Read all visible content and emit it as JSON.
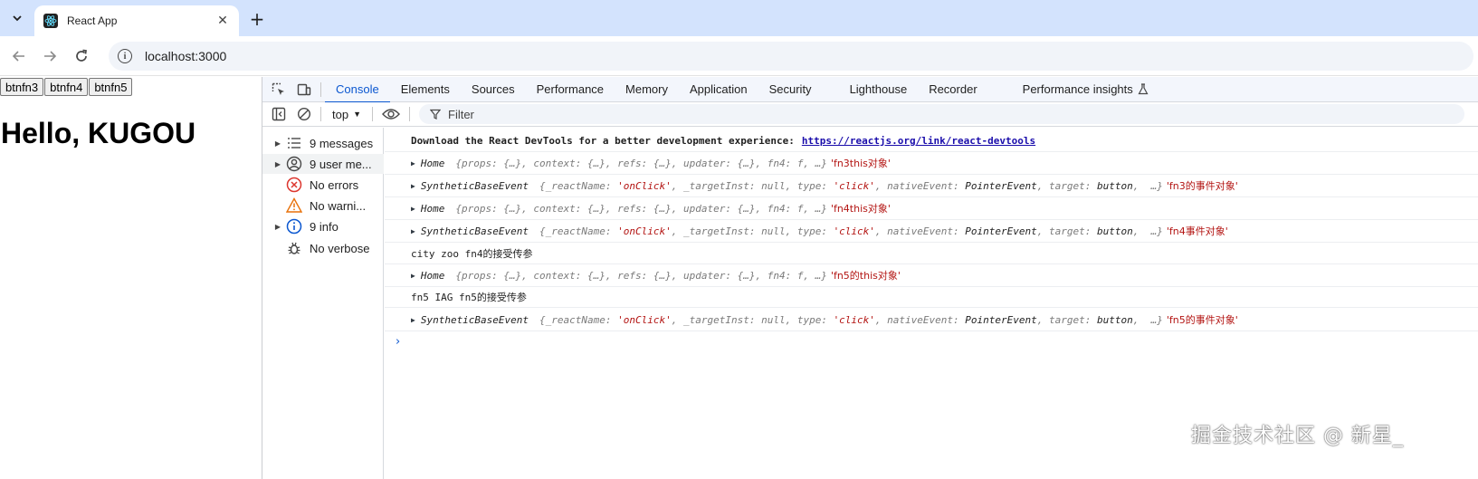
{
  "browser": {
    "tab_title": "React App",
    "url": "localhost:3000"
  },
  "page": {
    "buttons": [
      "btnfn3",
      "btnfn4",
      "btnfn5"
    ],
    "heading": "Hello, KUGOU"
  },
  "devtools": {
    "tabs": [
      "Console",
      "Elements",
      "Sources",
      "Performance",
      "Memory",
      "Application",
      "Security",
      "Lighthouse",
      "Recorder",
      "Performance insights"
    ],
    "active_tab": "Console",
    "context": "top",
    "filter_placeholder": "Filter",
    "sidebar": [
      {
        "label": "9 messages",
        "icon": "list-icon",
        "expandable": true
      },
      {
        "label": "9 user me...",
        "icon": "user-icon",
        "expandable": true,
        "selected": true
      },
      {
        "label": "No errors",
        "icon": "error-icon",
        "expandable": false
      },
      {
        "label": "No warni...",
        "icon": "warning-icon",
        "expandable": false
      },
      {
        "label": "9 info",
        "icon": "info-icon",
        "expandable": true
      },
      {
        "label": "No verbose",
        "icon": "bug-icon",
        "expandable": false
      }
    ],
    "console": {
      "banner_text": "Download the React DevTools for a better development experience:",
      "banner_link": "https://reactjs.org/link/react-devtools",
      "home_preview": "{props: {…}, context: {…}, refs: {…}, updater: {…}, fn4: f,  …}",
      "event_preview_a": "{_reactName: ",
      "event_preview_b": "'onClick'",
      "event_preview_c": ", _targetInst: null, type: ",
      "event_preview_d": "'click'",
      "event_preview_e": ", nativeEvent: ",
      "event_preview_f": "PointerEvent",
      "event_preview_g": ", target: ",
      "event_preview_h": "button",
      "event_preview_i": ",  …}",
      "home_label": "Home",
      "event_label": "SyntheticBaseEvent",
      "messages": [
        {
          "kind": "home",
          "tail": "'fn3this对象'"
        },
        {
          "kind": "event",
          "tail": "'fn3的事件对象'"
        },
        {
          "kind": "home",
          "tail": "'fn4this对象'"
        },
        {
          "kind": "event",
          "tail": "'fn4事件对象'"
        },
        {
          "kind": "plain",
          "text": "city zoo fn4的接受传参"
        },
        {
          "kind": "home",
          "tail": "'fn5的this对象'"
        },
        {
          "kind": "plain",
          "text": "fn5 IAG fn5的接受传参"
        },
        {
          "kind": "event",
          "tail": "'fn5的事件对象'"
        }
      ],
      "prompt": "›"
    }
  },
  "watermark": "掘金技术社区 @ 新星_",
  "colors": {
    "accent": "#0b57d0",
    "string_red": "#b31412",
    "tabstrip": "#d3e3fd"
  }
}
